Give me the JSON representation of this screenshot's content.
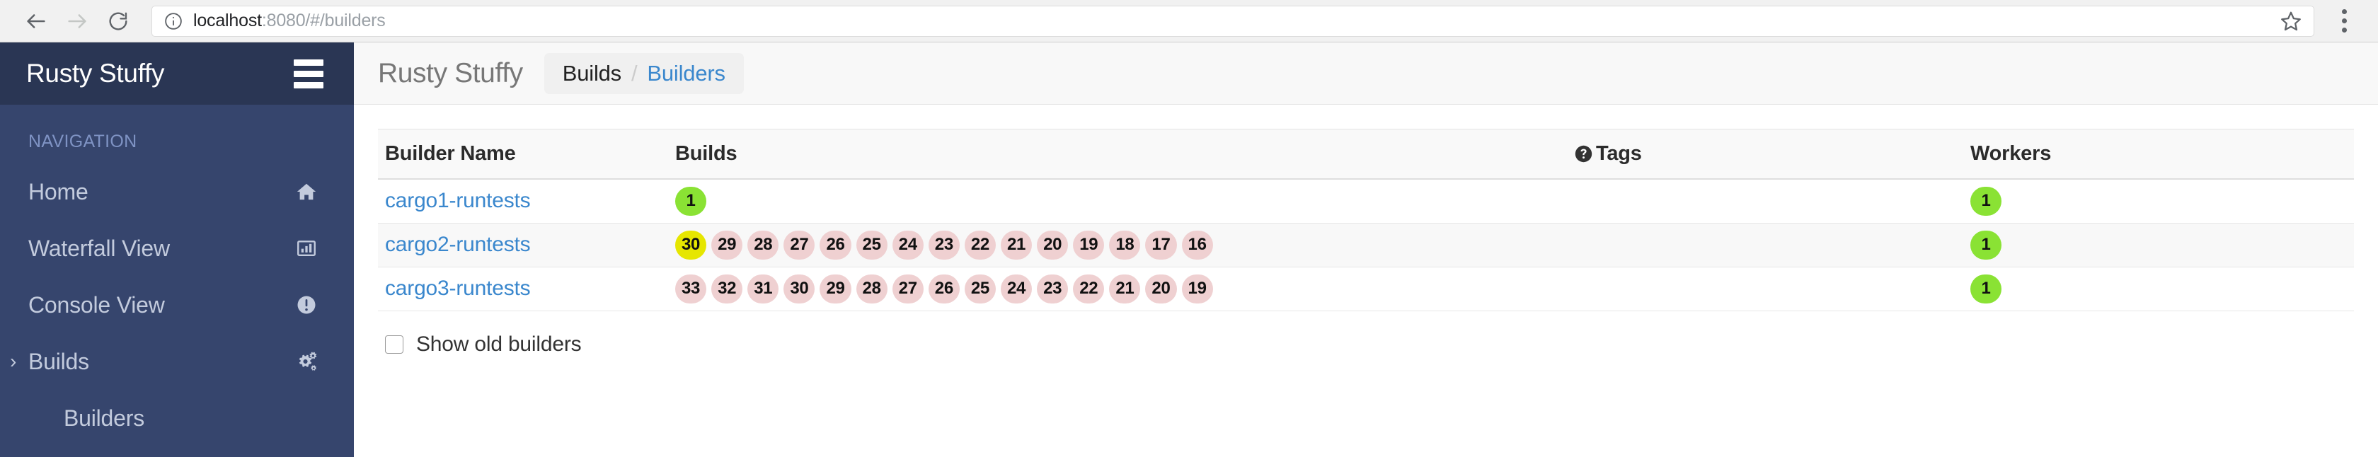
{
  "browser": {
    "back_icon": "arrow-left-icon",
    "forward_icon": "arrow-right-icon",
    "reload_icon": "reload-icon",
    "info_icon": "info-circle-icon",
    "url_host": "localhost",
    "url_rest": ":8080/#/builders",
    "url_full": "localhost:8080/#/builders",
    "bookmark_icon": "star-icon",
    "menu_icon": "kebab-menu-icon"
  },
  "sidebar": {
    "brand": "Rusty Stuffy",
    "menu_toggle_icon": "hamburger-icon",
    "section_label": "NAVIGATION",
    "items": [
      {
        "label": "Home",
        "icon": "home-icon",
        "sub": false,
        "chevron": ""
      },
      {
        "label": "Waterfall View",
        "icon": "bar-chart-icon",
        "sub": false,
        "chevron": ""
      },
      {
        "label": "Console View",
        "icon": "exclamation-circle-icon",
        "sub": false,
        "chevron": ""
      },
      {
        "label": "Builds",
        "icon": "gears-icon",
        "sub": false,
        "chevron": "›"
      },
      {
        "label": "Builders",
        "icon": "",
        "sub": true,
        "chevron": ""
      }
    ]
  },
  "header": {
    "app_title": "Rusty Stuffy",
    "breadcrumb": {
      "parent": "Builds",
      "separator": "/",
      "current": "Builders"
    }
  },
  "table": {
    "columns": {
      "name": "Builder Name",
      "builds": "Builds",
      "tags": "Tags",
      "tags_icon": "question-circle-icon",
      "workers": "Workers"
    },
    "rows": [
      {
        "name": "cargo1-runtests",
        "builds": [
          {
            "number": "1",
            "state": "success"
          }
        ],
        "tags": "",
        "workers": [
          {
            "number": "1",
            "state": "success"
          }
        ]
      },
      {
        "name": "cargo2-runtests",
        "builds": [
          {
            "number": "30",
            "state": "warning"
          },
          {
            "number": "29",
            "state": "failure"
          },
          {
            "number": "28",
            "state": "failure"
          },
          {
            "number": "27",
            "state": "failure"
          },
          {
            "number": "26",
            "state": "failure"
          },
          {
            "number": "25",
            "state": "failure"
          },
          {
            "number": "24",
            "state": "failure"
          },
          {
            "number": "23",
            "state": "failure"
          },
          {
            "number": "22",
            "state": "failure"
          },
          {
            "number": "21",
            "state": "failure"
          },
          {
            "number": "20",
            "state": "failure"
          },
          {
            "number": "19",
            "state": "failure"
          },
          {
            "number": "18",
            "state": "failure"
          },
          {
            "number": "17",
            "state": "failure"
          },
          {
            "number": "16",
            "state": "failure"
          }
        ],
        "tags": "",
        "workers": [
          {
            "number": "1",
            "state": "success"
          }
        ]
      },
      {
        "name": "cargo3-runtests",
        "builds": [
          {
            "number": "33",
            "state": "failure"
          },
          {
            "number": "32",
            "state": "failure"
          },
          {
            "number": "31",
            "state": "failure"
          },
          {
            "number": "30",
            "state": "failure"
          },
          {
            "number": "29",
            "state": "failure"
          },
          {
            "number": "28",
            "state": "failure"
          },
          {
            "number": "27",
            "state": "failure"
          },
          {
            "number": "26",
            "state": "failure"
          },
          {
            "number": "25",
            "state": "failure"
          },
          {
            "number": "24",
            "state": "failure"
          },
          {
            "number": "23",
            "state": "failure"
          },
          {
            "number": "22",
            "state": "failure"
          },
          {
            "number": "21",
            "state": "failure"
          },
          {
            "number": "20",
            "state": "failure"
          },
          {
            "number": "19",
            "state": "failure"
          }
        ],
        "tags": "",
        "workers": [
          {
            "number": "1",
            "state": "success"
          }
        ]
      }
    ]
  },
  "footer": {
    "show_old_builders_label": "Show old builders",
    "show_old_builders_checked": false
  },
  "colors": {
    "sidebar_bg": "#36456d",
    "sidebar_header_bg": "#2a3654",
    "link": "#3a87cd",
    "badge_success": "#8ae234",
    "badge_warning": "#e6e600",
    "badge_failure": "#efd0d1"
  }
}
